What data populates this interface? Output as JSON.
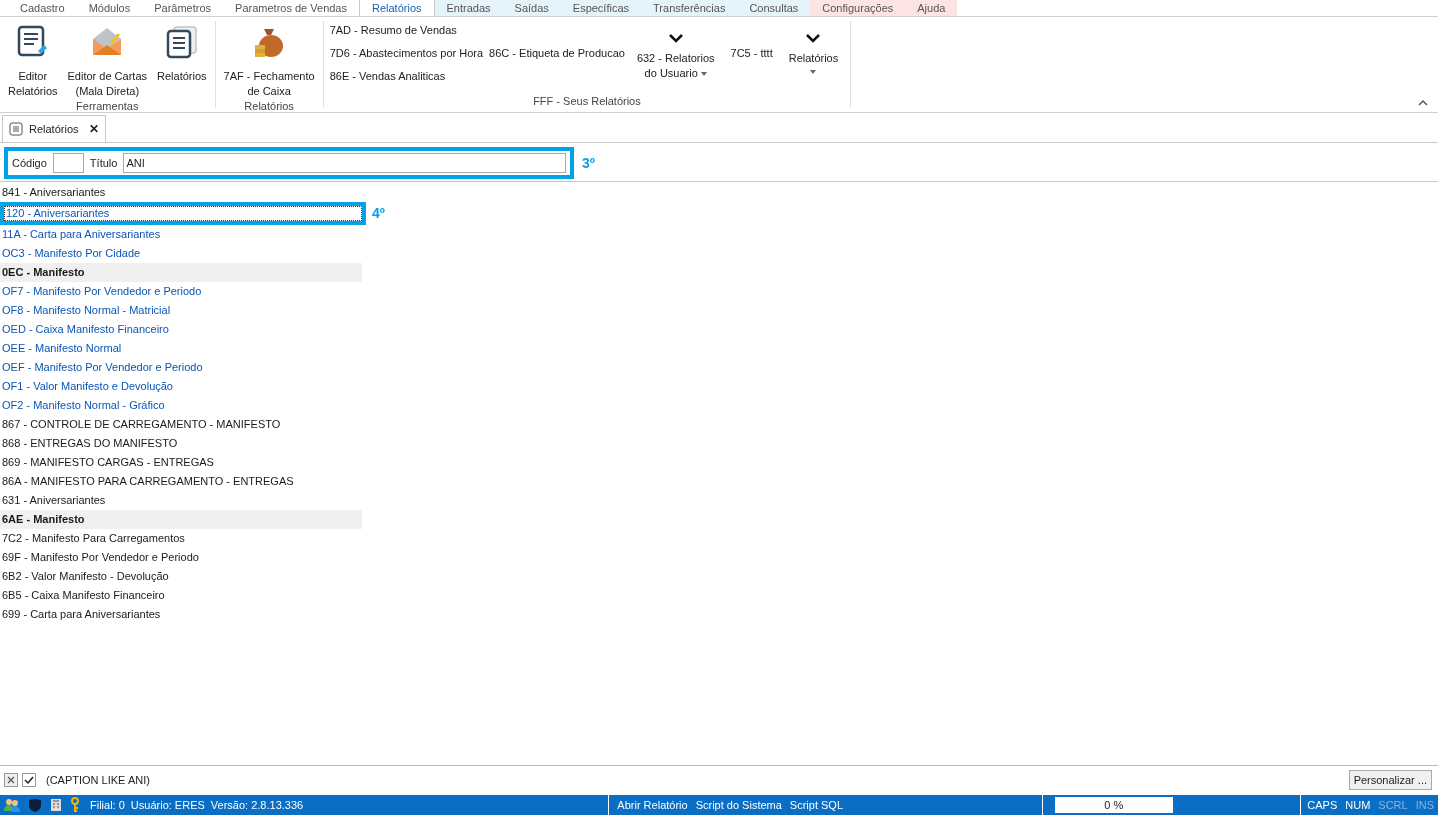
{
  "menu_tabs": [
    {
      "label": "Cadastro",
      "selected": false,
      "color": "#ffffff"
    },
    {
      "label": "Módulos",
      "selected": false,
      "color": "#ffffff"
    },
    {
      "label": "Parâmetros",
      "selected": false,
      "color": "#ffffff"
    },
    {
      "label": "Parametros de Vendas",
      "selected": false,
      "color": "#ffffff"
    },
    {
      "label": "Relatórios",
      "selected": true,
      "color": "#ffffff"
    },
    {
      "label": "Entradas",
      "selected": false,
      "color": "#e5f3fb"
    },
    {
      "label": "Saídas",
      "selected": false,
      "color": "#e5f3fb"
    },
    {
      "label": "Específicas",
      "selected": false,
      "color": "#e5f3fb"
    },
    {
      "label": "Transferências",
      "selected": false,
      "color": "#e5f3fb"
    },
    {
      "label": "Consultas",
      "selected": false,
      "color": "#e5f3fb"
    },
    {
      "label": "Configurações",
      "selected": false,
      "color": "#fde4e4"
    },
    {
      "label": "Ajuda",
      "selected": false,
      "color": "#fde4e4"
    }
  ],
  "ribbon": {
    "groups": [
      {
        "title": "Ferramentas",
        "buttons": [
          {
            "kind": "editor",
            "lines": [
              "Editor",
              "Relatórios"
            ]
          },
          {
            "kind": "letter",
            "lines": [
              "Editor de Cartas",
              "(Mala Direta)"
            ]
          },
          {
            "kind": "reports",
            "lines": [
              "Relatórios"
            ]
          }
        ]
      },
      {
        "title": "Relatórios",
        "buttons": [
          {
            "kind": "money",
            "lines": [
              "7AF - Fechamento",
              "de Caixa"
            ]
          }
        ]
      },
      {
        "title": "FFF - Seus Relatórios",
        "links": [
          "7AD - Resumo de Vendas",
          "7D6 - Abastecimentos por Hora",
          "86E - Vendas Analiticas"
        ],
        "link_col2": "86C - Etiqueta de Producao",
        "dropdowns": [
          {
            "lines": [
              "632 - Relatorios",
              "do Usuario"
            ]
          },
          {
            "lines": [
              "7C5 - tttt"
            ],
            "kind": "text"
          },
          {
            "lines": [
              "Relatórios"
            ]
          }
        ]
      }
    ]
  },
  "doc_tab": {
    "label": "Relatórios",
    "close": "✕"
  },
  "filter": {
    "code_label": "Código",
    "title_label": "Título",
    "title_value": "ANI",
    "annotation": "3º"
  },
  "reports": [
    {
      "kind": "item",
      "label": "841 - Aniversariantes",
      "color": "#1a1a1a",
      "selected": false
    },
    {
      "kind": "item",
      "label": "120 - Aniversariantes",
      "color": "#0a56b5",
      "selected": true,
      "annotation": "4º"
    },
    {
      "kind": "item",
      "label": "11A - Carta para Aniversariantes",
      "color": "#0a56b5",
      "selected": false
    },
    {
      "kind": "item",
      "label": "OC3 - Manifesto Por Cidade",
      "color": "#0a56b5",
      "selected": false
    },
    {
      "kind": "group",
      "label": "0EC - Manifesto",
      "color": "#1a1a1a",
      "selected": false
    },
    {
      "kind": "item",
      "label": "OF7 - Manifesto Por Vendedor e Periodo",
      "color": "#0a56b5",
      "selected": false
    },
    {
      "kind": "item",
      "label": "OF8 - Manifesto Normal - Matricial",
      "color": "#0a56b5",
      "selected": false
    },
    {
      "kind": "item",
      "label": "OED - Caixa Manifesto Financeiro",
      "color": "#0a56b5",
      "selected": false
    },
    {
      "kind": "item",
      "label": "OEE - Manifesto Normal",
      "color": "#0a56b5",
      "selected": false
    },
    {
      "kind": "item",
      "label": "OEF - Manifesto Por Vendedor e Periodo",
      "color": "#0a56b5",
      "selected": false
    },
    {
      "kind": "item",
      "label": "OF1 - Valor Manifesto e Devolução",
      "color": "#0a56b5",
      "selected": false
    },
    {
      "kind": "item",
      "label": "OF2 - Manifesto Normal - Gráfico",
      "color": "#0a56b5",
      "selected": false
    },
    {
      "kind": "item",
      "label": "867 - CONTROLE DE CARREGAMENTO - MANIFESTO",
      "color": "#1a1a1a",
      "selected": false
    },
    {
      "kind": "item",
      "label": "868 - ENTREGAS DO MANIFESTO",
      "color": "#1a1a1a",
      "selected": false
    },
    {
      "kind": "item",
      "label": "869 - MANIFESTO CARGAS - ENTREGAS",
      "color": "#1a1a1a",
      "selected": false
    },
    {
      "kind": "item",
      "label": "86A - MANIFESTO PARA CARREGAMENTO - ENTREGAS",
      "color": "#1a1a1a",
      "selected": false
    },
    {
      "kind": "item",
      "label": "631 - Aniversariantes",
      "color": "#1a1a1a",
      "selected": false
    },
    {
      "kind": "group",
      "label": "6AE - Manifesto",
      "color": "#1a1a1a",
      "selected": false
    },
    {
      "kind": "item",
      "label": "7C2 - Manifesto Para Carregamentos",
      "color": "#1a1a1a",
      "selected": false
    },
    {
      "kind": "item",
      "label": "69F - Manifesto Por Vendedor e Periodo",
      "color": "#1a1a1a",
      "selected": false
    },
    {
      "kind": "item",
      "label": "6B2 - Valor Manifesto - Devolução",
      "color": "#1a1a1a",
      "selected": false
    },
    {
      "kind": "item",
      "label": "6B5 - Caixa Manifesto Financeiro",
      "color": "#1a1a1a",
      "selected": false
    },
    {
      "kind": "item",
      "label": "699 - Carta para Aniversariantes",
      "color": "#1a1a1a",
      "selected": false
    }
  ],
  "filter_bar": {
    "active": true,
    "expression": "(CAPTION LIKE ANI)",
    "customize": "Personalizar ..."
  },
  "status_bar": {
    "info": [
      "Filial: 0",
      "Usuário: ERES",
      "Versão: 2.8.13.336"
    ],
    "actions": [
      "Abrir Relatório",
      "Script do Sistema",
      "Script SQL"
    ],
    "progress": {
      "level": 0,
      "reading": "0 %"
    },
    "keys": [
      {
        "label": "CAPS",
        "on": true
      },
      {
        "label": "NUM",
        "on": true
      },
      {
        "label": "SCRL",
        "on": false
      },
      {
        "label": "INS",
        "on": false
      }
    ]
  }
}
